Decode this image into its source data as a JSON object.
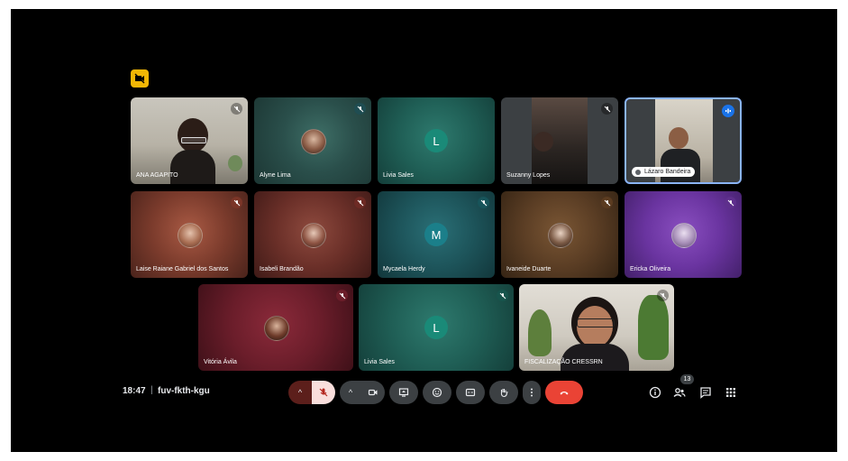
{
  "meeting": {
    "time": "18:47",
    "code": "fuv-fkth-kgu",
    "participant_count": "13"
  },
  "colors": {
    "accent": "#1a73e8",
    "end_call": "#ea4335",
    "tile_border": "#8ab4f8",
    "badge": "#f2b705"
  },
  "participants": [
    {
      "name": "ANA AGAPITO",
      "type": "video",
      "muted": true
    },
    {
      "name": "Alyne Lima",
      "type": "photo-avatar",
      "muted": true
    },
    {
      "name": "Livia Sales",
      "type": "letter-avatar",
      "letter": "L",
      "muted": false
    },
    {
      "name": "Suzanny Lopes",
      "type": "video",
      "muted": true
    },
    {
      "name": "Lázaro Bandeira",
      "type": "video",
      "speaking": true
    },
    {
      "name": "Laise Raiane Gabriel dos Santos",
      "type": "photo-avatar",
      "muted": true
    },
    {
      "name": "Isabeli Brandão",
      "type": "photo-avatar",
      "muted": true
    },
    {
      "name": "Mycaela Herdy",
      "type": "letter-avatar",
      "letter": "M",
      "muted": true
    },
    {
      "name": "Ivaneide Duarte",
      "type": "photo-avatar",
      "muted": true
    },
    {
      "name": "Ericka Oliveira",
      "type": "photo-avatar",
      "muted": true
    },
    {
      "name": "Vitória Ávila",
      "type": "photo-avatar",
      "muted": true
    },
    {
      "name": "Livia Sales",
      "type": "letter-avatar",
      "letter": "L",
      "muted": true
    },
    {
      "name": "FISCALIZAÇÃO CRESSRN",
      "type": "video",
      "muted": true
    }
  ],
  "controls": {
    "left": [
      "mic-options",
      "microphone-off",
      "camera-options",
      "camera",
      "present-screen",
      "emoji-reactions",
      "captions",
      "raise-hand",
      "more-options",
      "leave-call"
    ],
    "right": [
      "meeting-details",
      "people",
      "chat",
      "activities"
    ]
  }
}
